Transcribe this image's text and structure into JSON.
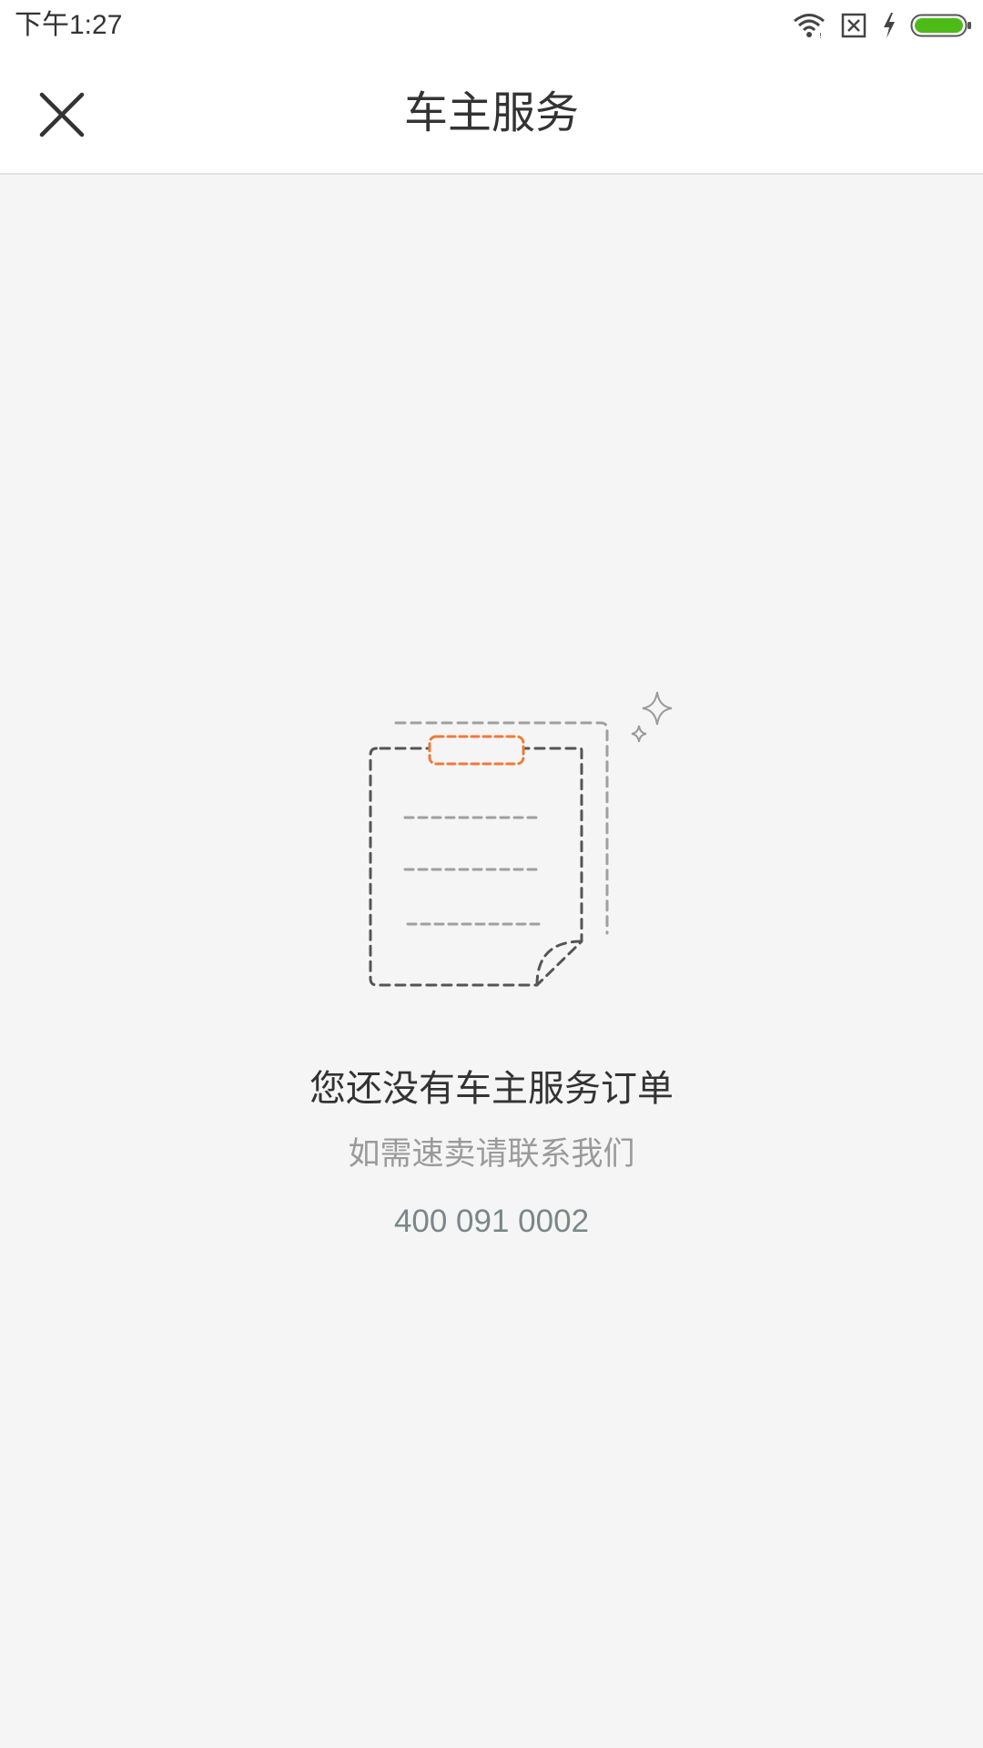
{
  "status_bar": {
    "time": "下午1:27",
    "icons": [
      "wifi-icon",
      "sim-error-icon",
      "charging-icon",
      "battery-icon"
    ],
    "battery_color": "#4cbb17"
  },
  "header": {
    "close_icon": "close-icon",
    "title": "车主服务"
  },
  "empty_state": {
    "illustration_icon": "empty-document-icon",
    "title": "您还没有车主服务订单",
    "subtitle": "如需速卖请联系我们",
    "phone": "400 091 0002",
    "accent_color": "#f07a3a"
  }
}
